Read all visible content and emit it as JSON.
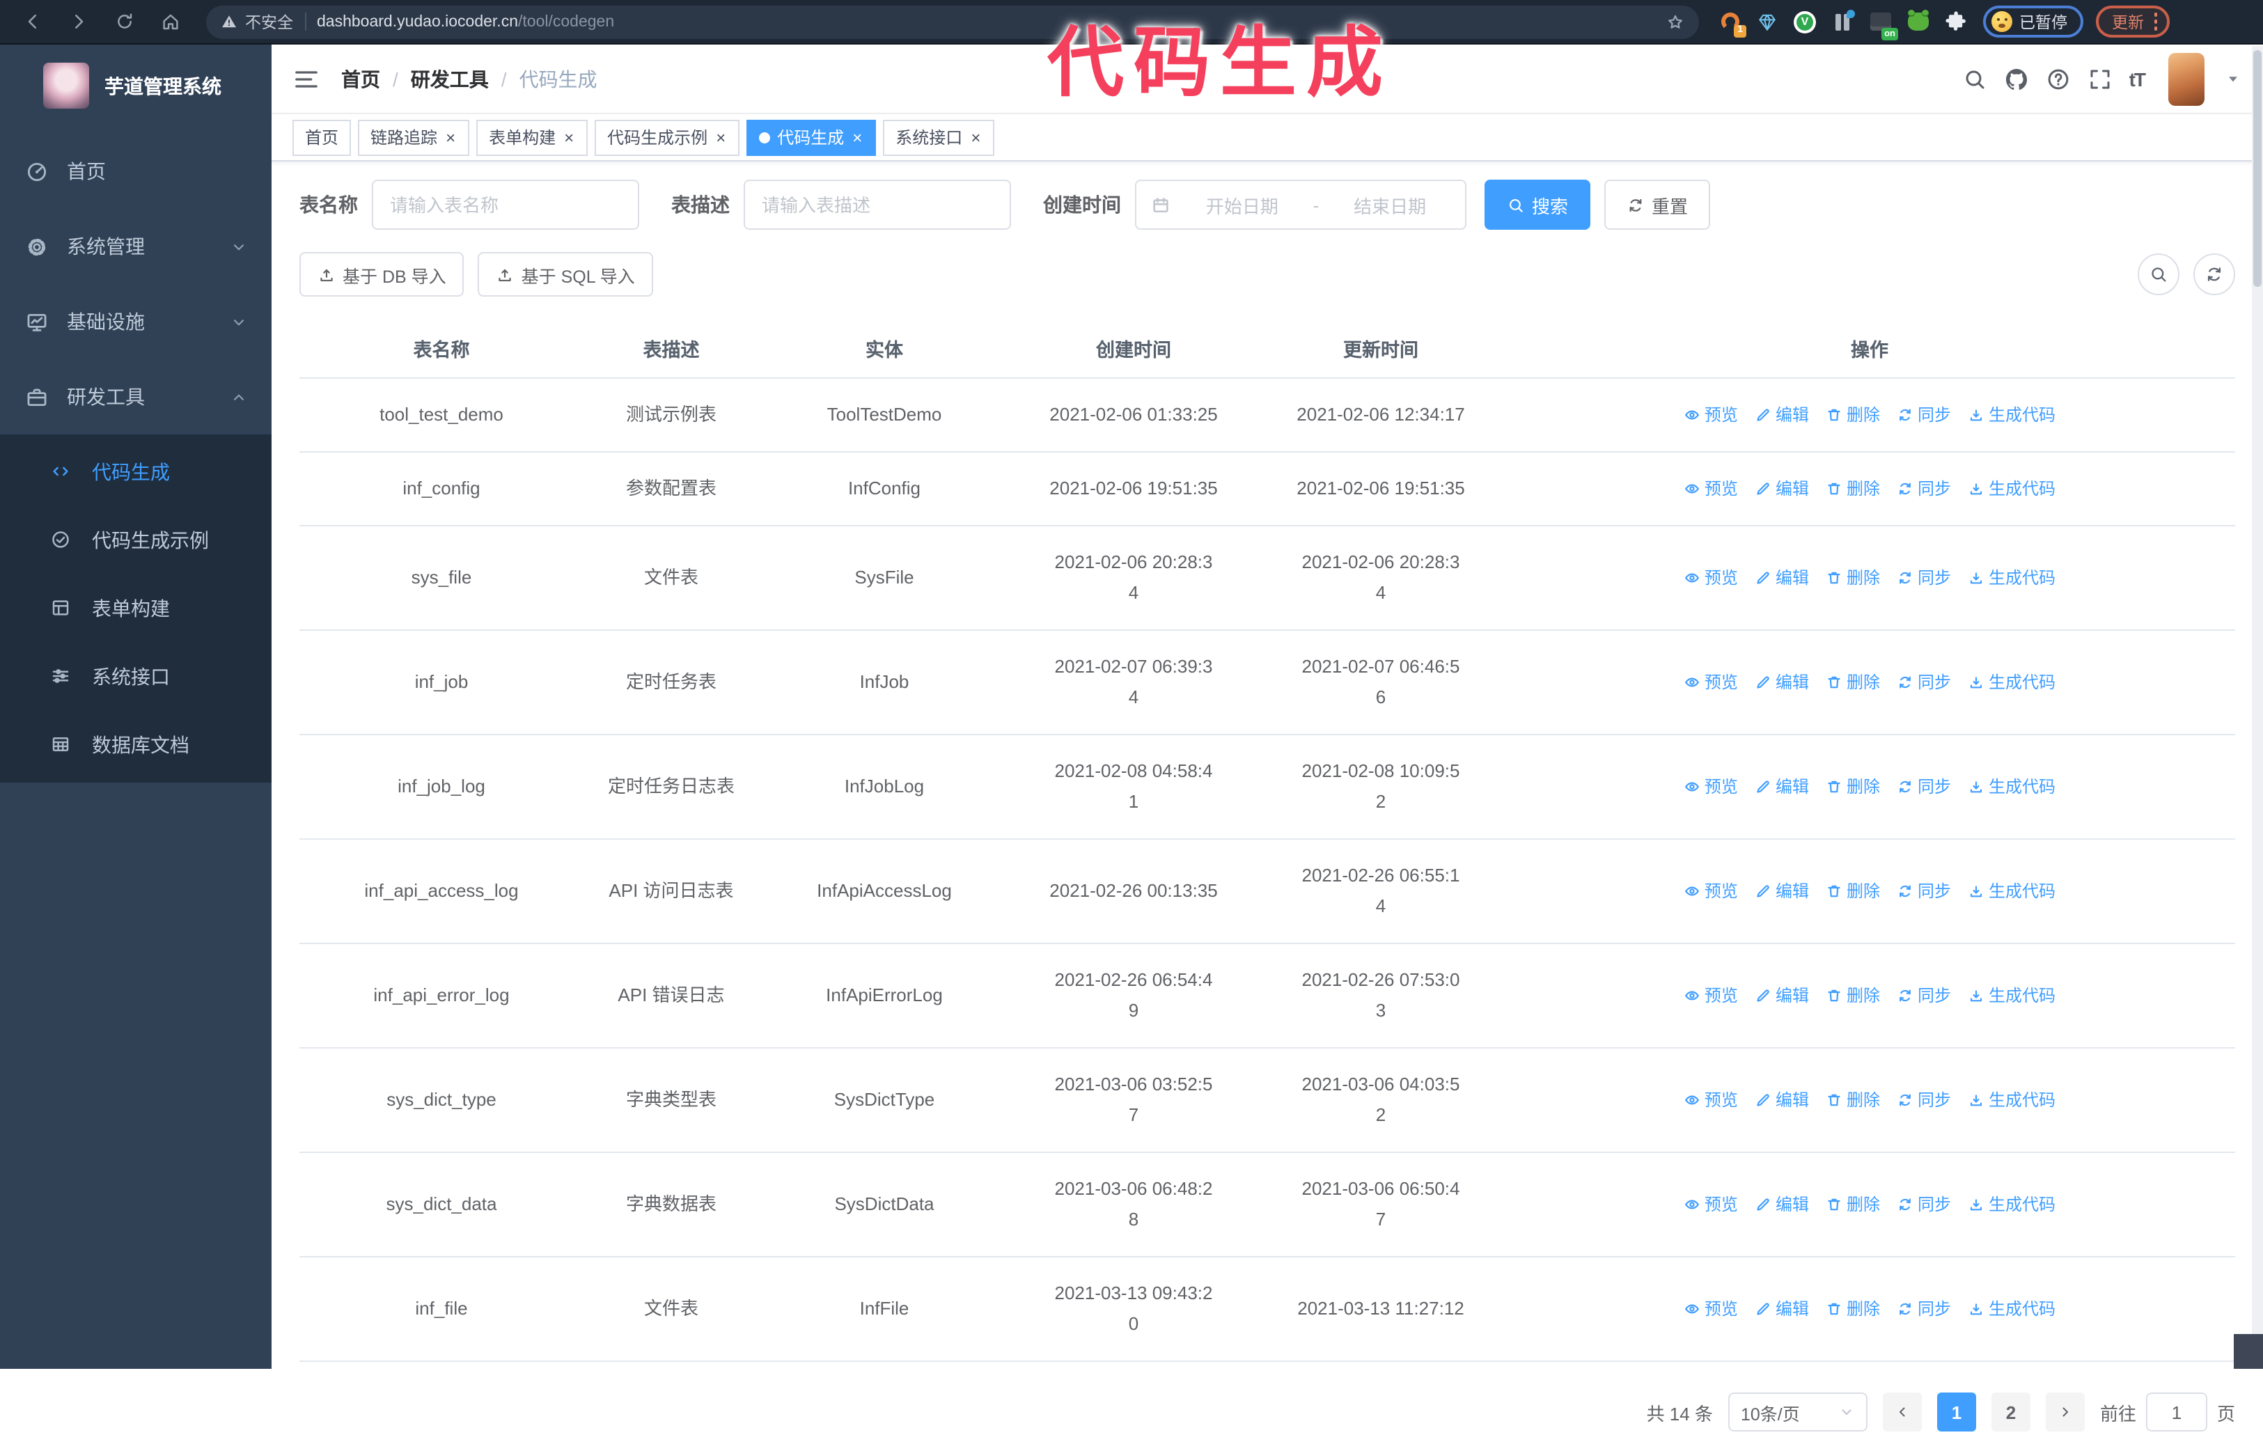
{
  "browser": {
    "security_warning": "不安全",
    "url_host": "dashboard.yudao.iocoder.cn",
    "url_path": "/tool/codegen",
    "ext_badge_1": "1",
    "ext_badge_on": "on",
    "check_mark": "V",
    "paused_label": "已暂停",
    "update_label": "更新"
  },
  "annotation": {
    "text": "代码生成"
  },
  "sidebar": {
    "title": "芋道管理系统",
    "menu": [
      {
        "label": "首页",
        "icon": "dashboard-icon"
      },
      {
        "label": "系统管理",
        "icon": "gear-icon",
        "chevron_down": true
      },
      {
        "label": "基础设施",
        "icon": "monitor-icon",
        "chevron_down": true
      },
      {
        "label": "研发工具",
        "icon": "toolbox-icon",
        "chevron_up": true
      }
    ],
    "submenu": [
      {
        "label": "代码生成",
        "icon": "code-icon",
        "active": true
      },
      {
        "label": "代码生成示例",
        "icon": "circle-check-icon"
      },
      {
        "label": "表单构建",
        "icon": "form-icon"
      },
      {
        "label": "系统接口",
        "icon": "sliders-icon"
      },
      {
        "label": "数据库文档",
        "icon": "database-table-icon"
      }
    ]
  },
  "navbar": {
    "breadcrumb": [
      {
        "label": "首页",
        "sep": true
      },
      {
        "label": "研发工具",
        "sep": true
      },
      {
        "label": "代码生成",
        "current": true
      }
    ]
  },
  "tags": [
    {
      "label": "首页"
    },
    {
      "label": "链路追踪",
      "closable": true
    },
    {
      "label": "表单构建",
      "closable": true
    },
    {
      "label": "代码生成示例",
      "closable": true
    },
    {
      "label": "代码生成",
      "closable": true,
      "active": true
    },
    {
      "label": "系统接口",
      "closable": true
    }
  ],
  "search_form": {
    "name_label": "表名称",
    "name_placeholder": "请输入表名称",
    "desc_label": "表描述",
    "desc_placeholder": "请输入表描述",
    "time_label": "创建时间",
    "start_placeholder": "开始日期",
    "range_separator": "-",
    "end_placeholder": "结束日期",
    "search_label": "搜索",
    "reset_label": "重置"
  },
  "toolbar": {
    "import_db_label": "基于 DB 导入",
    "import_sql_label": "基于 SQL 导入"
  },
  "table": {
    "columns": [
      "表名称",
      "表描述",
      "实体",
      "创建时间",
      "更新时间",
      "操作"
    ],
    "actions": [
      {
        "label": "预览",
        "icon": "eye-icon"
      },
      {
        "label": "编辑",
        "icon": "edit-icon"
      },
      {
        "label": "删除",
        "icon": "delete-icon"
      },
      {
        "label": "同步",
        "icon": "refresh-icon"
      },
      {
        "label": "生成代码",
        "icon": "download-icon"
      }
    ],
    "rows": [
      {
        "name": "tool_test_demo",
        "desc": "测试示例表",
        "entity": "ToolTestDemo",
        "created": "2021-02-06 01:33:25",
        "updated": "2021-02-06 12:34:17"
      },
      {
        "name": "inf_config",
        "desc": "参数配置表",
        "entity": "InfConfig",
        "created": "2021-02-06 19:51:35",
        "updated": "2021-02-06 19:51:35"
      },
      {
        "name": "sys_file",
        "desc": "文件表",
        "entity": "SysFile",
        "created": "2021-02-06 20:28:3\n4",
        "updated": "2021-02-06 20:28:3\n4"
      },
      {
        "name": "inf_job",
        "desc": "定时任务表",
        "entity": "InfJob",
        "created": "2021-02-07 06:39:3\n4",
        "updated": "2021-02-07 06:46:5\n6"
      },
      {
        "name": "inf_job_log",
        "desc": "定时任务日志表",
        "entity": "InfJobLog",
        "created": "2021-02-08 04:58:4\n1",
        "updated": "2021-02-08 10:09:5\n2"
      },
      {
        "name": "inf_api_access_log",
        "desc": "API 访问日志表",
        "entity": "InfApiAccessLog",
        "created": "2021-02-26 00:13:35",
        "updated": "2021-02-26 06:55:1\n4"
      },
      {
        "name": "inf_api_error_log",
        "desc": "API 错误日志",
        "entity": "InfApiErrorLog",
        "created": "2021-02-26 06:54:4\n9",
        "updated": "2021-02-26 07:53:0\n3"
      },
      {
        "name": "sys_dict_type",
        "desc": "字典类型表",
        "entity": "SysDictType",
        "created": "2021-03-06 03:52:5\n7",
        "updated": "2021-03-06 04:03:5\n2"
      },
      {
        "name": "sys_dict_data",
        "desc": "字典数据表",
        "entity": "SysDictData",
        "created": "2021-03-06 06:48:2\n8",
        "updated": "2021-03-06 06:50:4\n7"
      },
      {
        "name": "inf_file",
        "desc": "文件表",
        "entity": "InfFile",
        "created": "2021-03-13 09:43:2\n0",
        "updated": "2021-03-13 11:27:12"
      }
    ]
  },
  "pagination": {
    "total": "共 14 条",
    "page_size": "10条/页",
    "pages": [
      {
        "label": "1",
        "active": true
      },
      {
        "label": "2"
      }
    ],
    "goto_label": "前往",
    "goto_value": "1",
    "page_unit": "页"
  },
  "colors": {
    "primary": "#409EFF",
    "sidebar_bg": "#304156",
    "submenu_bg": "#1f2d3d",
    "annotation": "#f4405c"
  }
}
